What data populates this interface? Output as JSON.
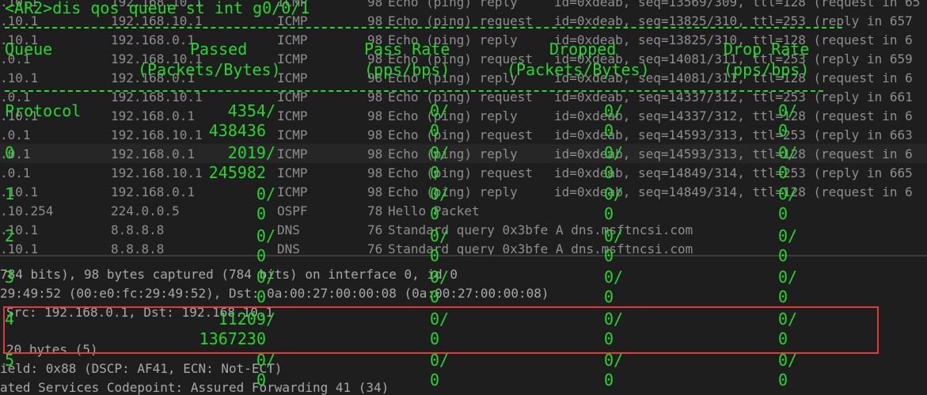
{
  "background": {
    "packet_rows": [
      {
        "src": ".10.1",
        "dst": "192.168.10.1",
        "proto": "ICMP",
        "len": "98",
        "info": "Echo (ping) reply",
        "detail": "id=0xdeab, seq=13569/309, ttl=128 (request in 65"
      },
      {
        "src": ".10.1",
        "dst": "192.168.10.1",
        "proto": "ICMP",
        "len": "98",
        "info": "Echo (ping) request",
        "detail": "id=0xdeab, seq=13825/310, ttl=253 (reply in 657"
      },
      {
        "src": ".10.1",
        "dst": "192.168.0.1",
        "proto": "ICMP",
        "len": "98",
        "info": "Echo (ping) reply",
        "detail": "id=0xdeab, seq=13825/310, ttl=128 (request in 6"
      },
      {
        "src": ".0.1",
        "dst": "192.168.10.1",
        "proto": "ICMP",
        "len": "98",
        "info": "Echo (ping) request",
        "detail": "id=0xdeab, seq=14081/311, ttl=253 (reply in 659"
      },
      {
        "src": ".10.1",
        "dst": "192.168.0.1",
        "proto": "ICMP",
        "len": "98",
        "info": "Echo (ping) reply",
        "detail": "id=0xdeab, seq=14081/311, ttl=128 (request in 6"
      },
      {
        "src": ".0.1",
        "dst": "192.168.10.1",
        "proto": "ICMP",
        "len": "98",
        "info": "Echo (ping) request",
        "detail": "id=0xdeab, seq=14337/312, ttl=253 (reply in 661"
      },
      {
        "src": ".10.1",
        "dst": "192.168.0.1",
        "proto": "ICMP",
        "len": "98",
        "info": "Echo (ping) reply",
        "detail": "id=0xdeab, seq=14337/312, ttl=128 (request in 6"
      },
      {
        "src": ".0.1",
        "dst": "192.168.10.1",
        "proto": "ICMP",
        "len": "98",
        "info": "Echo (ping) request",
        "detail": "id=0xdeab, seq=14593/313, ttl=253 (reply in 663"
      },
      {
        "src": ".0.1",
        "dst": "192.168.0.1",
        "proto": "ICMP",
        "len": "98",
        "info": "Echo (ping) reply",
        "detail": "id=0xdeab, seq=14593/313, ttl=128 (request in 6"
      },
      {
        "src": ".0.1",
        "dst": "192.168.10.1",
        "proto": "ICMP",
        "len": "98",
        "info": "Echo (ping) request",
        "detail": "id=0xdeab, seq=14849/314, ttl=253 (reply in 665"
      },
      {
        "src": ".10.1",
        "dst": "192.168.0.1",
        "proto": "ICMP",
        "len": "98",
        "info": "Echo (ping) reply",
        "detail": "id=0xdeab, seq=14849/314, ttl=128 (request in 6"
      },
      {
        "src": ".10.254",
        "dst": "224.0.0.5",
        "proto": "OSPF",
        "len": "78",
        "info": "Hello Packet",
        "detail": ""
      },
      {
        "src": ".10.1",
        "dst": "8.8.8.8",
        "proto": "DNS",
        "len": "76",
        "info": "Standard query 0x3bfe A dns.msftncsi.com",
        "detail": ""
      },
      {
        "src": ".10.1",
        "dst": "8.8.8.8",
        "proto": "DNS",
        "len": "76",
        "info": "Standard query 0x3bfe A dns.msftncsi.com",
        "detail": ""
      }
    ],
    "details": [
      "784 bits), 98 bytes captured (784 bits) on interface 0, id 0",
      "29:49:52 (00:e0:fc:29:49:52), Dst: 0a:00:27:00:00:08 (0a:00:27:00:00:08)",
      " Src: 192.168.0.1, Dst: 192.168.10.1",
      "20 bytes (5)",
      "ield: 0x88 (DSCP: AF41, ECN: Not-ECT)",
      "ated Services Codepoint: Assured Forwarding 41 (34)"
    ]
  },
  "terminal": {
    "command": "<AR2>dis qos queue st int g0/0/1",
    "headers": {
      "queue": "Queue",
      "passed": "Passed",
      "passed_sub": "(Packets/Bytes)",
      "pass_rate": "Pass Rate",
      "pass_rate_sub": "(pps/bps)",
      "dropped": "Dropped",
      "dropped_sub": "(Packets/Bytes)",
      "drop_rate": "Drop Rate",
      "drop_rate_sub": "(pps/bps)"
    },
    "rows": [
      {
        "queue": "Protocol",
        "passed": "4354/",
        "passed2": "438436",
        "pass_rate": "0/",
        "pass_rate2": "0",
        "dropped": "0/",
        "dropped2": "0",
        "drop_rate": "0/",
        "drop_rate2": "0"
      },
      {
        "queue": "0",
        "passed": "2019/",
        "passed2": "245982",
        "pass_rate": "0/",
        "pass_rate2": "0",
        "dropped": "0/",
        "dropped2": "0",
        "drop_rate": "0/",
        "drop_rate2": "0"
      },
      {
        "queue": "1",
        "passed": "0/",
        "passed2": "0",
        "pass_rate": "0/",
        "pass_rate2": "0",
        "dropped": "0/",
        "dropped2": "0",
        "drop_rate": "0/",
        "drop_rate2": "0"
      },
      {
        "queue": "2",
        "passed": "0/",
        "passed2": "0",
        "pass_rate": "0/",
        "pass_rate2": "0",
        "dropped": "0/",
        "dropped2": "0",
        "drop_rate": "0/",
        "drop_rate2": "0"
      },
      {
        "queue": "3",
        "passed": "0/",
        "passed2": "0",
        "pass_rate": "0/",
        "pass_rate2": "0",
        "dropped": "0/",
        "dropped2": "0",
        "drop_rate": "0/",
        "drop_rate2": "0"
      },
      {
        "queue": "4",
        "passed": "11209/",
        "passed2": "1367230",
        "pass_rate": "0/",
        "pass_rate2": "0",
        "dropped": "0/",
        "dropped2": "0",
        "drop_rate": "0/",
        "drop_rate2": "0"
      },
      {
        "queue": "5",
        "passed": "0/",
        "passed2": "0",
        "pass_rate": "0/",
        "pass_rate2": "0",
        "dropped": "0/",
        "dropped2": "0",
        "drop_rate": "0/",
        "drop_rate2": "0"
      }
    ]
  },
  "highlight_color": "#e53935",
  "terminal_text_color": "#27d62e"
}
